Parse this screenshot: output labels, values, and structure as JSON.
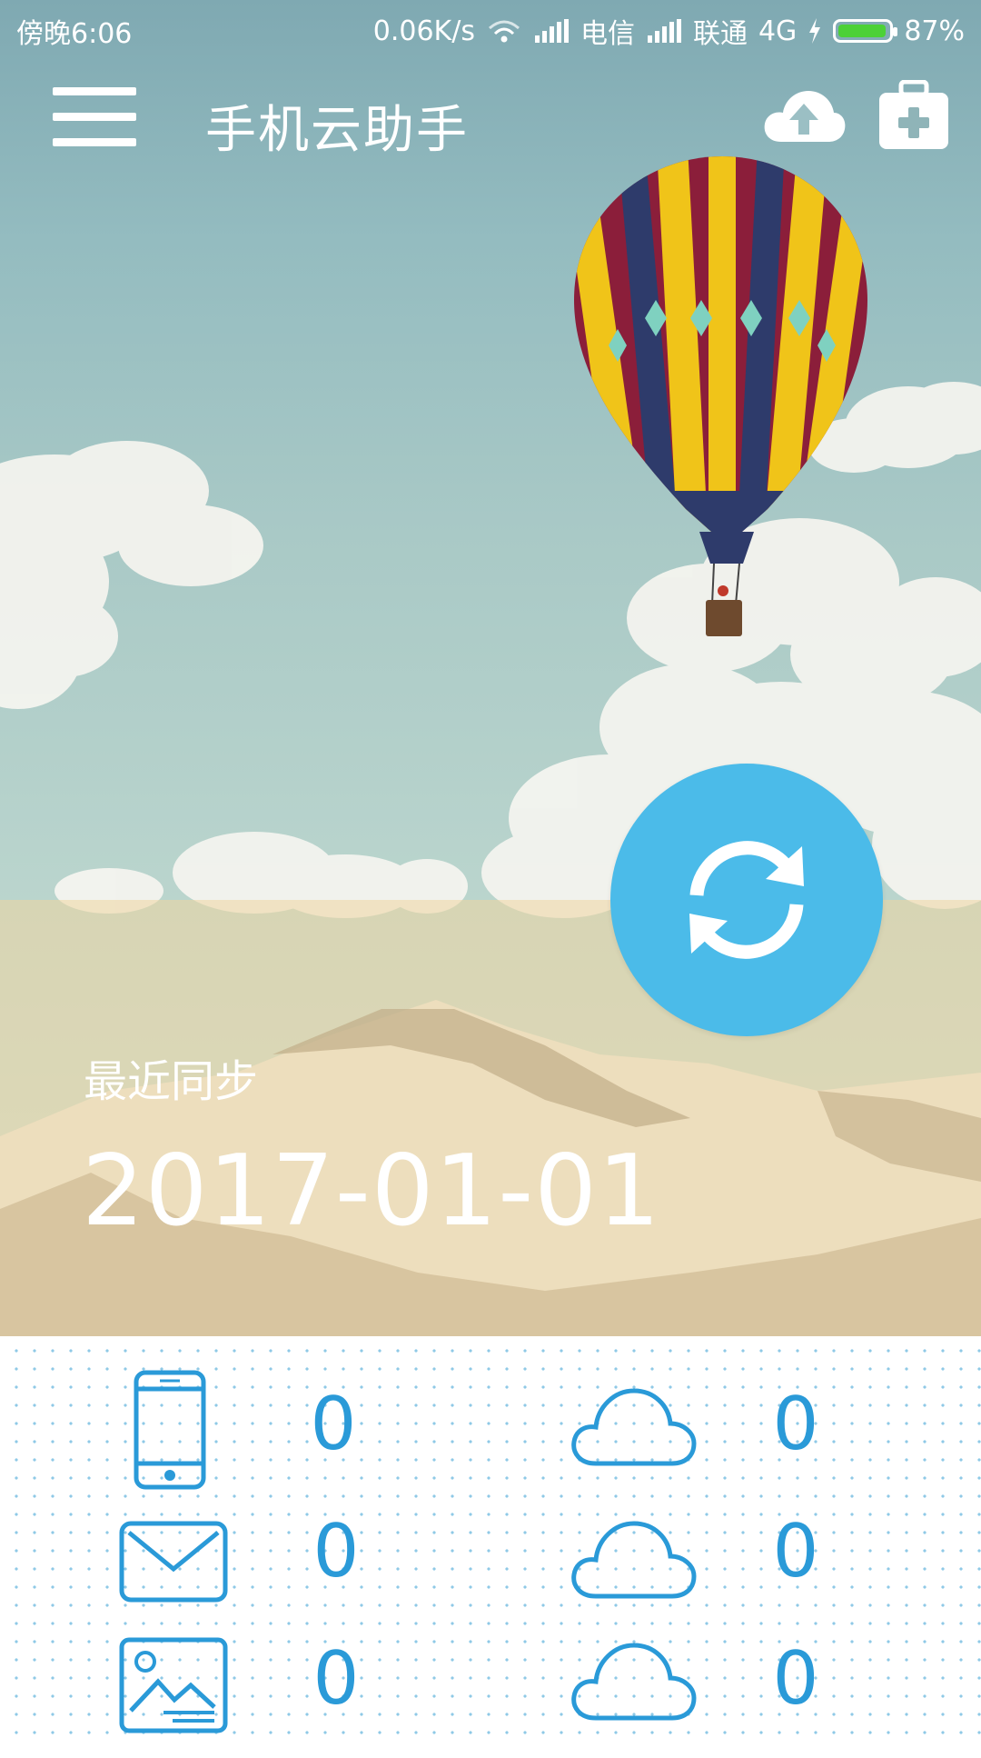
{
  "status_bar": {
    "time": "傍晚6:06",
    "net_speed": "0.06K/s",
    "carrier1": "电信",
    "carrier2": "联通",
    "network_type": "4G",
    "battery": "87%"
  },
  "header": {
    "title": "手机云助手",
    "menu_icon": "hamburger-menu-icon",
    "upload_icon": "cloud-upload-icon",
    "toolbox_icon": "medical-kit-icon"
  },
  "sync": {
    "button_icon": "sync-refresh-icon",
    "last_sync_label": "最近同步",
    "last_sync_date": "2017-01-01"
  },
  "stats": [
    {
      "local_icon": "phone-icon",
      "local_count": "0",
      "cloud_icon": "cloud-icon",
      "cloud_count": "0"
    },
    {
      "local_icon": "mail-icon",
      "local_count": "0",
      "cloud_icon": "cloud-icon",
      "cloud_count": "0"
    },
    {
      "local_icon": "image-icon",
      "local_count": "0",
      "cloud_icon": "cloud-icon",
      "cloud_count": "0"
    }
  ],
  "colors": {
    "accent_blue": "#4bbbe9",
    "icon_blue": "#2a9ad8",
    "sand_band": "#eed6a0"
  }
}
